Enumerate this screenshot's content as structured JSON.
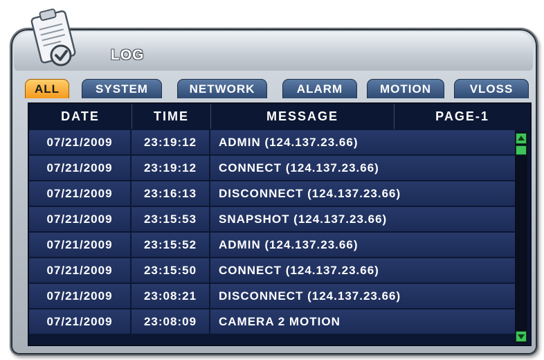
{
  "window": {
    "title": "LOG",
    "icon": "clipboard-check-icon"
  },
  "tabs": [
    {
      "label": "ALL",
      "active": true
    },
    {
      "label": "SYSTEM",
      "active": false
    },
    {
      "label": "NETWORK",
      "active": false
    },
    {
      "label": "ALARM",
      "active": false
    },
    {
      "label": "MOTION",
      "active": false
    },
    {
      "label": "VLOSS",
      "active": false
    }
  ],
  "table": {
    "headers": {
      "date": "DATE",
      "time": "TIME",
      "message": "MESSAGE",
      "page": "PAGE-1"
    },
    "rows": [
      {
        "date": "07/21/2009",
        "time": "23:19:12",
        "message": "ADMIN (124.137.23.66)"
      },
      {
        "date": "07/21/2009",
        "time": "23:19:12",
        "message": "CONNECT (124.137.23.66)"
      },
      {
        "date": "07/21/2009",
        "time": "23:16:13",
        "message": "DISCONNECT (124.137.23.66)"
      },
      {
        "date": "07/21/2009",
        "time": "23:15:53",
        "message": "SNAPSHOT (124.137.23.66)"
      },
      {
        "date": "07/21/2009",
        "time": "23:15:52",
        "message": "ADMIN (124.137.23.66)"
      },
      {
        "date": "07/21/2009",
        "time": "23:15:50",
        "message": "CONNECT (124.137.23.66)"
      },
      {
        "date": "07/21/2009",
        "time": "23:08:21",
        "message": "DISCONNECT (124.137.23.66)"
      },
      {
        "date": "07/21/2009",
        "time": "23:08:09",
        "message": "CAMERA 2 MOTION"
      }
    ]
  },
  "colors": {
    "accent": "#f49a1d",
    "row_bg": "#22335f",
    "scroll": "#3ec35a"
  }
}
